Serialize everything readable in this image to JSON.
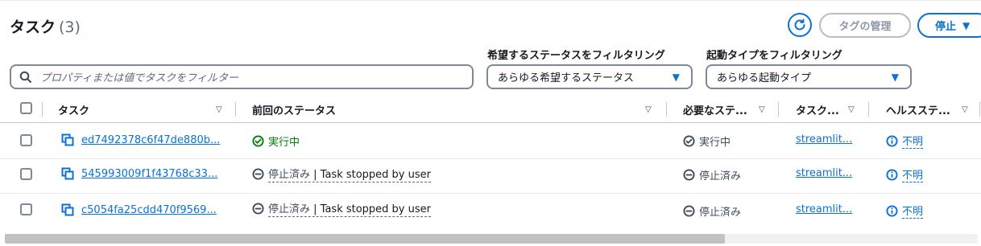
{
  "header": {
    "title": "タスク",
    "count": "(3)",
    "tag_button": "タグの管理",
    "stop_button": "停止"
  },
  "filters": {
    "search_placeholder": "プロパティまたは値でタスクをフィルター",
    "desired_status_label": "希望するステータスをフィルタリング",
    "desired_status_value": "あらゆる希望するステータス",
    "launch_type_label": "起動タイプをフィルタリング",
    "launch_type_value": "あらゆる起動タイプ"
  },
  "columns": [
    "タスク",
    "前回のステータス",
    "必要なステ...",
    "タスク...",
    "ヘルスステ..."
  ],
  "rows": [
    {
      "task_id": "ed7492378c6f47de880b...",
      "last_status": "実行中",
      "last_status_detail": "",
      "desired_status": "実行中",
      "task_def": "streamlit...",
      "health": "不明"
    },
    {
      "task_id": "545993009f1f43768c33...",
      "last_status": "停止済み",
      "last_status_detail": " | Task stopped by user",
      "desired_status": "停止済み",
      "task_def": "streamlit...",
      "health": "不明"
    },
    {
      "task_id": "c5054fa25cdd470f9569...",
      "last_status": "停止済み",
      "last_status_detail": " | Task stopped by user",
      "desired_status": "停止済み",
      "task_def": "streamlit...",
      "health": "不明"
    }
  ],
  "icons": {
    "refresh": "refresh-icon",
    "search": "search-icon",
    "copy": "copy-icon",
    "running": "check-circle-icon",
    "stopped": "minus-circle-icon",
    "info": "info-circle-icon"
  },
  "colors": {
    "accent": "#0972d3",
    "running": "#037f0c",
    "muted": "#5f6b7a"
  }
}
